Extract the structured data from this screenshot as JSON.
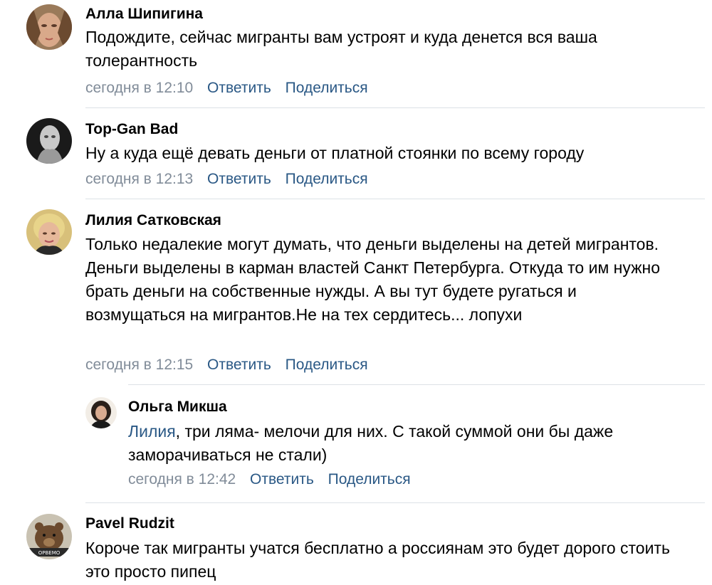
{
  "comments": [
    {
      "author": "Алла Шипигина",
      "text": "Подождите, сейчас мигранты вам устроят и куда денется вся ваша толерантность",
      "time": "сегодня в 12:10",
      "reply_label": "Ответить",
      "share_label": "Поделиться"
    },
    {
      "author": "Top-Gan Bad",
      "text": "Ну а куда ещё девать деньги от платной стоянки по всему городу",
      "time": "сегодня в 12:13",
      "reply_label": "Ответить",
      "share_label": "Поделиться"
    },
    {
      "author": "Лилия Сатковская",
      "text": "Только недалекие могут думать, что деньги выделены на детей мигрантов. Деньги выделены в карман властей Санкт Петербурга. Откуда то им нужно брать деньги на собственные нужды. А вы тут будете ругаться и возмущаться на мигрантов.Не на тех сердитесь... лопухи",
      "time": "сегодня в 12:15",
      "reply_label": "Ответить",
      "share_label": "Поделиться"
    },
    {
      "author": "Ольга Микша",
      "mention": "Лилия",
      "text": ", три ляма- мелочи для них. С такой суммой они бы даже заморачиваться не стали)",
      "time": "сегодня в 12:42",
      "reply_label": "Ответить",
      "share_label": "Поделиться"
    },
    {
      "author": "Pavel Rudzit",
      "avatar_caption": "ОРВЕМО",
      "text": "Короче так мигранты учатся бесплатно а россиянам это будет дорого стоить это просто пипец"
    }
  ],
  "colors": {
    "link": "#2a5885",
    "meta": "#818c99",
    "divider": "#dce1e6"
  }
}
